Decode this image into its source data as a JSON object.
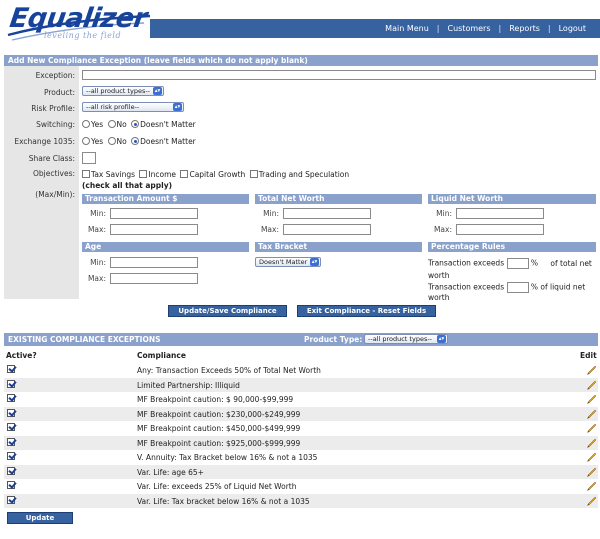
{
  "header": {
    "logo_text": "Equalizer",
    "logo_tagline": "leveling the field",
    "nav": [
      "Main Menu",
      "Customers",
      "Reports",
      "Logout"
    ],
    "nav_separator": "|"
  },
  "form": {
    "title": "Add New Compliance Exception (leave fields which do not apply blank)",
    "labels": {
      "exception": "Exception:",
      "product": "Product:",
      "risk_profile": "Risk Profile:",
      "switching": "Switching:",
      "exchange_1035": "Exchange 1035:",
      "share_class": "Share Class:",
      "objectives": "Objectives:",
      "maxmin": "(Max/Min):"
    },
    "exception_value": "",
    "product_select": "--all product types--",
    "risk_profile_select": "--all risk profile--",
    "switching_options": [
      "Yes",
      "No",
      "Doesn't Matter"
    ],
    "switching_selected": "Doesn't Matter",
    "exchange_options": [
      "Yes",
      "No",
      "Doesn't Matter"
    ],
    "exchange_selected": "Doesn't Matter",
    "share_class_value": "",
    "objectives_options": [
      "Tax Savings",
      "Income",
      "Capital Growth",
      "Trading and Speculation"
    ],
    "objectives_note": "(check all that apply)",
    "min_label": "Min:",
    "max_label": "Max:",
    "panels": {
      "transaction_amount": "Transaction Amount $",
      "total_net_worth": "Total Net Worth",
      "liquid_net_worth": "Liquid Net Worth",
      "age": "Age",
      "tax_bracket": "Tax Bracket",
      "percentage_rules": "Percentage Rules"
    },
    "tax_bracket_select": "Doesn't Matter",
    "pct_rule_1_prefix": "Transaction exceeds",
    "pct_rule_1_unit": "%",
    "pct_rule_1_suffix": "of total net",
    "pct_rule_1_wrap": "worth",
    "pct_rule_2_prefix": "Transaction exceeds",
    "pct_rule_2_suffix": "% of liquid net worth",
    "save_button": "Update/Save Compliance Setting",
    "exit_button": "Exit Compliance - Reset Fields"
  },
  "existing": {
    "title": "EXISTING COMPLIANCE EXCEPTIONS",
    "product_type_label": "Product Type:",
    "product_type_select": "--all product types--",
    "columns": {
      "active": "Active?",
      "compliance": "Compliance",
      "edit": "Edit"
    },
    "rows": [
      "Any: Transaction Exceeds 50% of Total Net Worth",
      "Limited Partnership: Illiquid",
      "MF Breakpoint caution: $ 90,000-$99,999",
      "MF Breakpoint caution: $230,000-$249,999",
      "MF Breakpoint caution: $450,000-$499,999",
      "MF Breakpoint caution: $925,000-$999,999",
      "V. Annuity: Tax Bracket below 16% & not a 1035",
      "Var. Life: age 65+",
      "Var. Life: exceeds 25% of Liquid Net Worth",
      "Var. Life: Tax bracket below 16% & not a 1035"
    ],
    "update_button": "Update Checked"
  },
  "colors": {
    "nav_bg": "#36629f",
    "section_bg": "#8aa1cc",
    "logo_blue": "#17449a",
    "pencil": "#e0a020"
  }
}
